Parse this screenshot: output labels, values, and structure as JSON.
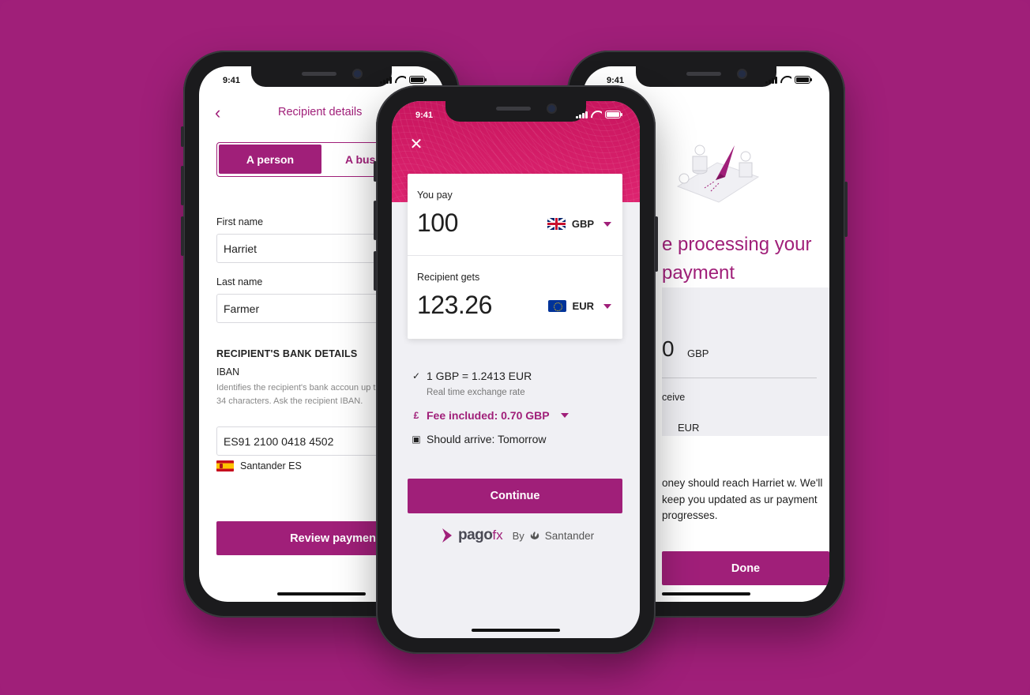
{
  "status": {
    "time": "9:41"
  },
  "left_screen": {
    "title": "Recipient details",
    "segment": {
      "person": "A person",
      "business": "A bus"
    },
    "first_name": {
      "label": "First name",
      "value": "Harriet"
    },
    "last_name": {
      "label": "Last name",
      "value": "Farmer"
    },
    "bank_section": "RECIPIENT'S BANK DETAILS",
    "iban": {
      "label": "IBAN",
      "help": "Identifies the recipient's bank accoun up to 34 characters. Ask the recipient IBAN.",
      "value": "ES91 2100 0418 4502"
    },
    "bank_name": "Santander ES",
    "review_button": "Review payment"
  },
  "center_screen": {
    "you_pay": {
      "label": "You pay",
      "amount": "100",
      "currency": "GBP"
    },
    "recipient_gets": {
      "label": "Recipient gets",
      "amount": "123.26",
      "currency": "EUR"
    },
    "rate": "1 GBP = 1.2413 EUR",
    "rate_note": "Real time exchange rate",
    "fee": "Fee included: 0.70 GBP",
    "arrival": "Should arrive: Tomorrow",
    "continue_button": "Continue",
    "brand": {
      "pago": "pago",
      "fx": "fx",
      "by": "By",
      "partner": "Santander"
    }
  },
  "right_screen": {
    "title": "e processing your payment",
    "amount_partial": "0",
    "currency1": "GBP",
    "receive_label": "ceive",
    "currency2": "EUR",
    "info": "oney should reach Harriet w. We'll keep you updated as ur payment progresses.",
    "done_button": "Done"
  },
  "colors": {
    "background": "#a01f79",
    "brand": "#a01f79",
    "hero": "#d61e6a"
  }
}
